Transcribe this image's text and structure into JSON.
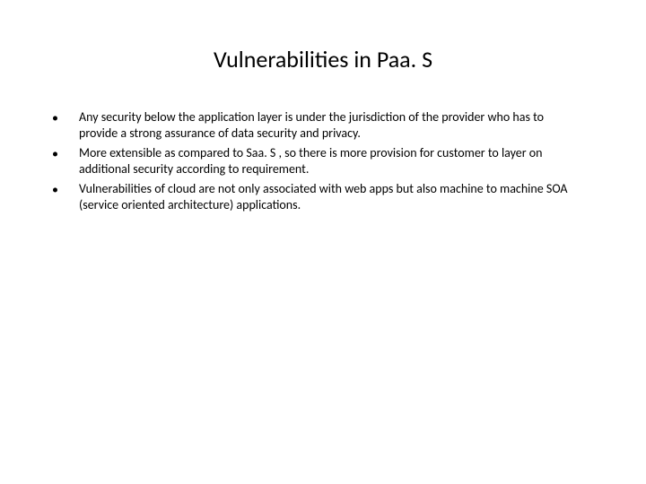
{
  "title": "Vulnerabilities in Paa. S",
  "bullets": [
    "Any security below the application layer is under the jurisdiction of the provider who has to provide a strong assurance of data security and privacy.",
    "More extensible as compared to Saa. S , so there is more provision for customer to layer on additional security according to requirement.",
    "Vulnerabilities of cloud are not only associated with web apps but also machine to machine SOA (service oriented architecture) applications."
  ]
}
